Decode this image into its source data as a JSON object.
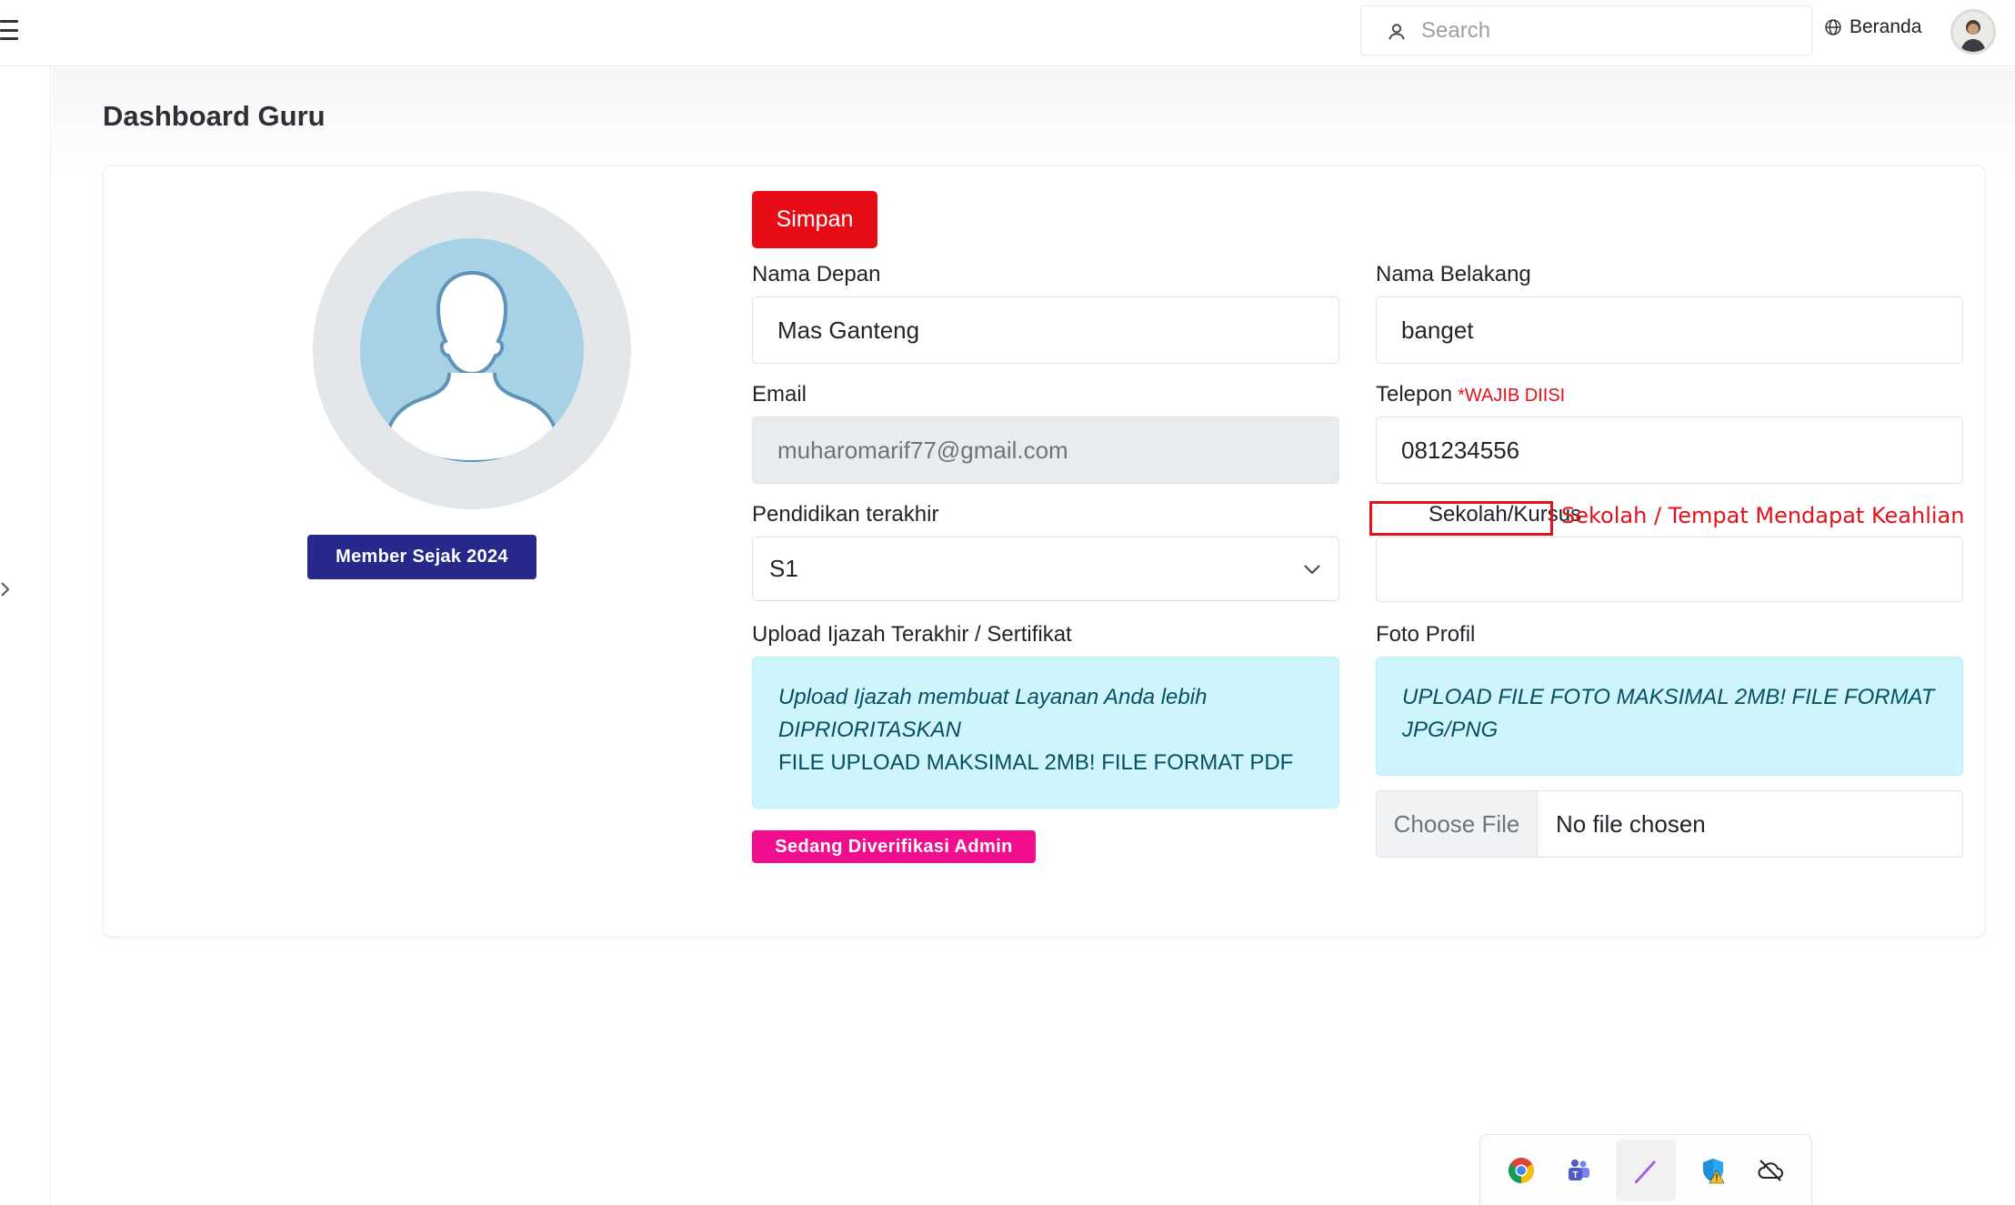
{
  "topbar": {
    "search_placeholder": "Search",
    "home_label": "Beranda"
  },
  "page": {
    "title": "Dashboard Guru"
  },
  "profile": {
    "member_badge": "Member Sejak 2024"
  },
  "form": {
    "save_label": "Simpan",
    "first_name": {
      "label": "Nama Depan",
      "value": "Mas Ganteng"
    },
    "last_name": {
      "label": "Nama Belakang",
      "value": "banget"
    },
    "email": {
      "label": "Email",
      "value": "muharomarif77@gmail.com"
    },
    "phone": {
      "label": "Telepon",
      "required_note": "*WAJIB DIISI",
      "value": "081234556"
    },
    "education": {
      "label": "Pendidikan terakhir",
      "selected": "S1"
    },
    "school": {
      "label": "Sekolah/Kursus",
      "value": "",
      "annotation": "Sekolah / Tempat Mendapat Keahlian"
    },
    "certificate": {
      "label": "Upload Ijazah Terakhir / Sertifikat",
      "info_line1": "Upload Ijazah membuat Layanan Anda lebih DIPRIORITASKAN",
      "info_line2": "FILE UPLOAD MAKSIMAL 2MB! FILE FORMAT PDF",
      "status_badge": "Sedang Diverifikasi Admin"
    },
    "photo": {
      "label": "Foto Profil",
      "info": "UPLOAD FILE FOTO MAKSIMAL 2MB! FILE FORMAT JPG/PNG",
      "choose_label": "Choose File",
      "no_file_label": "No file chosen"
    }
  },
  "taskbar": {
    "icons": [
      "chrome-icon",
      "teams-icon",
      "pen-icon",
      "defender-warning-icon",
      "cloud-off-icon"
    ]
  },
  "colors": {
    "primary_red": "#e60b14",
    "badge_navy": "#26288c",
    "badge_pink": "#f20c8e",
    "info_bg": "#cef4fc",
    "info_text": "#055160"
  }
}
